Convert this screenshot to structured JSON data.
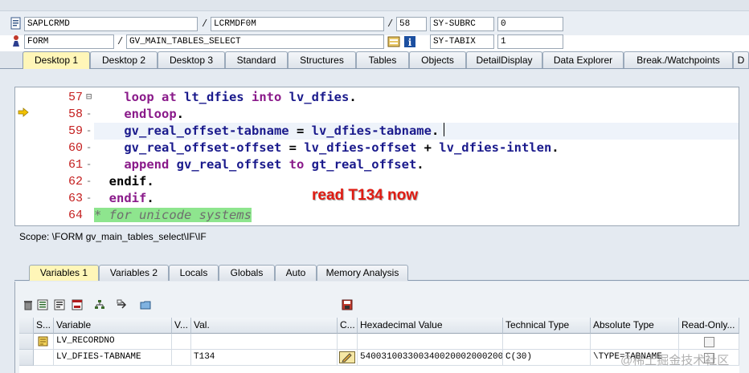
{
  "header": {
    "row1": {
      "program": "SAPLCRMD",
      "include": "LCRMDF0M",
      "line": "58",
      "field_name": "SY-SUBRC",
      "field_value": "0"
    },
    "row2": {
      "event_type": "FORM",
      "event_name": "GV_MAIN_TABLES_SELECT",
      "field_name": "SY-TABIX",
      "field_value": "1"
    },
    "separator": "/"
  },
  "desktop_tabs": [
    "Desktop 1",
    "Desktop 2",
    "Desktop 3",
    "Standard",
    "Structures",
    "Tables",
    "Objects",
    "DetailDisplay",
    "Data Explorer",
    "Break./Watchpoints",
    "D"
  ],
  "code": {
    "lines": [
      {
        "num": "57",
        "fold": "⊟",
        "indent": "    ",
        "parts": [
          [
            "kw",
            "loop at "
          ],
          [
            "id",
            "lt_dfies "
          ],
          [
            "kw",
            "into "
          ],
          [
            "id",
            "lv_dfies"
          ],
          [
            "blk",
            "."
          ]
        ]
      },
      {
        "num": "58",
        "fold": "-",
        "indent": "    ",
        "parts": [
          [
            "kw",
            "endloop"
          ],
          [
            "blk",
            "."
          ]
        ]
      },
      {
        "num": "59",
        "fold": "-",
        "indent": "    ",
        "parts": [
          [
            "id",
            "gv_real_offset-tabname "
          ],
          [
            "blk",
            "= "
          ],
          [
            "id",
            "lv_dfies-tabname"
          ],
          [
            "blk",
            "."
          ]
        ]
      },
      {
        "num": "60",
        "fold": "-",
        "indent": "    ",
        "parts": [
          [
            "id",
            "gv_real_offset-offset "
          ],
          [
            "blk",
            "= "
          ],
          [
            "id",
            "lv_dfies-offset "
          ],
          [
            "blk",
            "+ "
          ],
          [
            "id",
            "lv_dfies-intlen"
          ],
          [
            "blk",
            "."
          ]
        ]
      },
      {
        "num": "61",
        "fold": "-",
        "indent": "    ",
        "parts": [
          [
            "kw",
            "append "
          ],
          [
            "id",
            "gv_real_offset "
          ],
          [
            "kw",
            "to "
          ],
          [
            "id",
            "gt_real_offset"
          ],
          [
            "blk",
            "."
          ]
        ]
      },
      {
        "num": "62",
        "fold": "-",
        "indent": "  ",
        "parts": [
          [
            "blk",
            "endif."
          ]
        ]
      },
      {
        "num": "63",
        "fold": "-",
        "indent": "  ",
        "parts": [
          [
            "kw",
            "endif"
          ],
          [
            "blk",
            "."
          ]
        ]
      },
      {
        "num": "64",
        "fold": "",
        "indent": "",
        "parts": [
          [
            "cmt",
            "* for unicode systems"
          ]
        ]
      }
    ]
  },
  "annotation": "read T134 now",
  "scope": "Scope: \\FORM gv_main_tables_select\\IF\\IF",
  "variable_tabs": [
    "Variables 1",
    "Variables 2",
    "Locals",
    "Globals",
    "Auto",
    "Memory Analysis"
  ],
  "grid": {
    "headers": [
      "S...",
      "Variable",
      "V...",
      "Val.",
      "C...",
      "Hexadecimal Value",
      "Technical Type",
      "Absolute Type",
      "Read-Only..."
    ],
    "rows": [
      {
        "variable": "LV_RECORDNO",
        "value": "",
        "hex": "",
        "tech": "",
        "abs": ""
      },
      {
        "variable": "LV_DFIES-TABNAME",
        "value": "T134",
        "hex": "5400310033003400200020002000...",
        "tech": "C(30)",
        "abs": "\\TYPE=TABNAME"
      }
    ]
  },
  "watermark": "@稀土掘金技术社区",
  "colors": {
    "line_numbers": "#c41e1e",
    "keyword": "#8a1a8a",
    "identifier": "#1a1a8c",
    "comment_bg": "#8ee58e",
    "active_tab": "#fff6b8",
    "annotation": "#e01b12"
  }
}
